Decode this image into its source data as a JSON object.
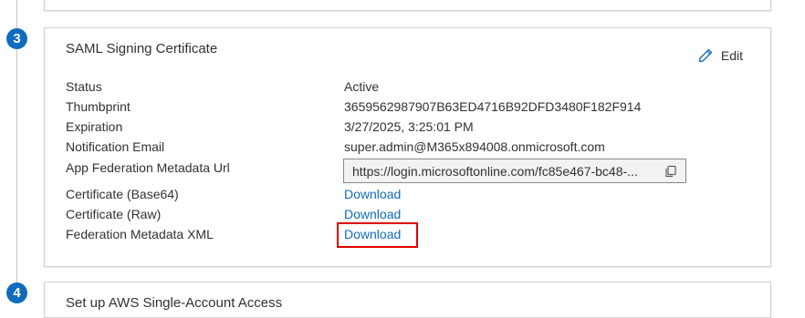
{
  "steps": {
    "current": "3",
    "next": "4"
  },
  "certificate_card": {
    "title": "SAML Signing Certificate",
    "edit_label": "Edit",
    "rows": {
      "status": {
        "label": "Status",
        "value": "Active"
      },
      "thumbprint": {
        "label": "Thumbprint",
        "value": "3659562987907B63ED4716B92DFD3480F182F914"
      },
      "expiration": {
        "label": "Expiration",
        "value": "3/27/2025, 3:25:01 PM"
      },
      "notification_email": {
        "label": "Notification Email",
        "value": "super.admin@M365x894008.onmicrosoft.com"
      },
      "metadata_url": {
        "label": "App Federation Metadata Url",
        "value": "https://login.microsoftonline.com/fc85e467-bc48-..."
      },
      "cert_base64": {
        "label": "Certificate (Base64)",
        "value": "Download"
      },
      "cert_raw": {
        "label": "Certificate (Raw)",
        "value": "Download"
      },
      "federation_xml": {
        "label": "Federation Metadata XML",
        "value": "Download"
      }
    }
  },
  "next_card": {
    "title": "Set up AWS Single-Account Access"
  },
  "colors": {
    "accent": "#0f6cbd",
    "highlight": "#e00000",
    "text": "#323130"
  },
  "icons": {
    "edit": "pencil-icon",
    "copy": "copy-icon"
  }
}
